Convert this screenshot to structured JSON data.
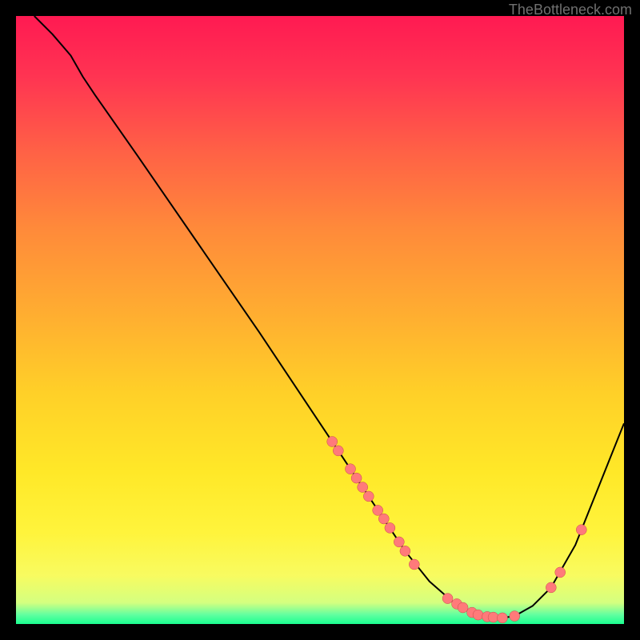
{
  "attribution": "TheBottleneck.com",
  "chart_data": {
    "type": "line",
    "title": "",
    "xlabel": "",
    "ylabel": "",
    "xlim": [
      0,
      100
    ],
    "ylim": [
      0,
      100
    ],
    "curve": [
      {
        "x": 3,
        "y": 100
      },
      {
        "x": 6,
        "y": 97
      },
      {
        "x": 9,
        "y": 93.5
      },
      {
        "x": 11,
        "y": 90
      },
      {
        "x": 13,
        "y": 87
      },
      {
        "x": 20,
        "y": 77
      },
      {
        "x": 30,
        "y": 62.5
      },
      {
        "x": 40,
        "y": 48
      },
      {
        "x": 50,
        "y": 33
      },
      {
        "x": 56,
        "y": 24
      },
      {
        "x": 60,
        "y": 18
      },
      {
        "x": 64,
        "y": 12
      },
      {
        "x": 68,
        "y": 7
      },
      {
        "x": 72,
        "y": 3.5
      },
      {
        "x": 76,
        "y": 1.5
      },
      {
        "x": 80,
        "y": 1
      },
      {
        "x": 82,
        "y": 1.3
      },
      {
        "x": 85,
        "y": 3
      },
      {
        "x": 88,
        "y": 6
      },
      {
        "x": 92,
        "y": 13
      },
      {
        "x": 96,
        "y": 23
      },
      {
        "x": 100,
        "y": 33
      }
    ],
    "dots": [
      {
        "x": 52,
        "y": 30
      },
      {
        "x": 53,
        "y": 28.5
      },
      {
        "x": 55,
        "y": 25.5
      },
      {
        "x": 56,
        "y": 24
      },
      {
        "x": 57,
        "y": 22.5
      },
      {
        "x": 58,
        "y": 21
      },
      {
        "x": 59.5,
        "y": 18.7
      },
      {
        "x": 60.5,
        "y": 17.3
      },
      {
        "x": 61.5,
        "y": 15.8
      },
      {
        "x": 63,
        "y": 13.5
      },
      {
        "x": 64,
        "y": 12
      },
      {
        "x": 65.5,
        "y": 9.8
      },
      {
        "x": 71,
        "y": 4.2
      },
      {
        "x": 72.5,
        "y": 3.3
      },
      {
        "x": 73.5,
        "y": 2.7
      },
      {
        "x": 75,
        "y": 1.9
      },
      {
        "x": 76,
        "y": 1.5
      },
      {
        "x": 77.5,
        "y": 1.2
      },
      {
        "x": 78.5,
        "y": 1.1
      },
      {
        "x": 80,
        "y": 1.0
      },
      {
        "x": 82,
        "y": 1.3
      },
      {
        "x": 88,
        "y": 6
      },
      {
        "x": 89.5,
        "y": 8.5
      },
      {
        "x": 93,
        "y": 15.5
      }
    ],
    "colors": {
      "curve": "#000000",
      "dot_fill": "#ff7a7a",
      "dot_stroke": "#c74a4a"
    }
  }
}
